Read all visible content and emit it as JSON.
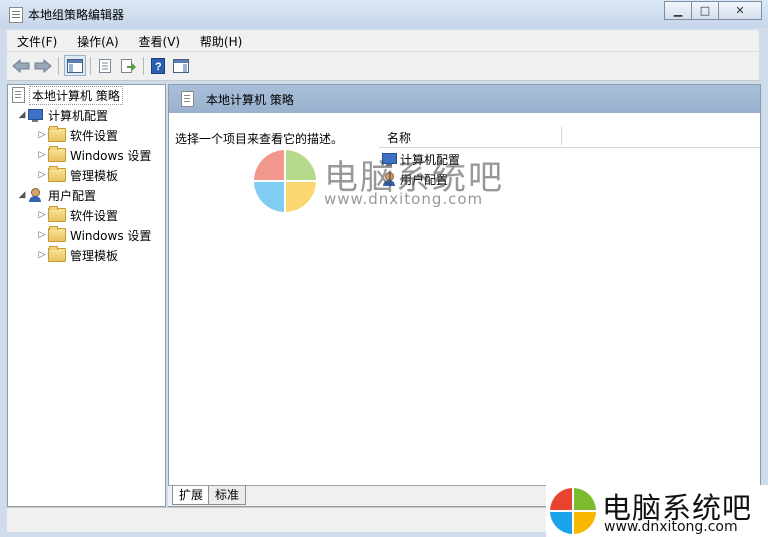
{
  "window": {
    "title": "本地组策略编辑器",
    "minimize_symbol": "▁",
    "maximize_symbol": "□",
    "close_symbol": "✕"
  },
  "menu": [
    {
      "label": "文件(F)"
    },
    {
      "label": "操作(A)"
    },
    {
      "label": "查看(V)"
    },
    {
      "label": "帮助(H)"
    }
  ],
  "toolbar": {
    "icons": [
      "back-icon",
      "forward-icon",
      "show-hide-tree-icon",
      "properties-icon",
      "export-list-icon",
      "help-icon",
      "show-hide-action-pane-icon"
    ]
  },
  "tree": {
    "root": "本地计算机 策略",
    "computer_config": "计算机配置",
    "user_config": "用户配置",
    "children": [
      "软件设置",
      "Windows 设置",
      "管理模板"
    ],
    "expand_arrow": "◢",
    "collapsed_arrow": "▷"
  },
  "content": {
    "header_title": "本地计算机 策略",
    "description": "选择一个项目来查看它的描述。",
    "column_name": "名称",
    "items": [
      "计算机配置",
      "用户配置"
    ]
  },
  "tabs": [
    {
      "label": "扩展"
    },
    {
      "label": "标准"
    }
  ],
  "watermark": {
    "text": "电脑系统吧",
    "url": "www.dnxitong.com"
  },
  "colors": {
    "logo_red": "#e8432e",
    "logo_green": "#7cbb30",
    "logo_blue": "#1aa3e8",
    "logo_yellow": "#f8b800"
  }
}
